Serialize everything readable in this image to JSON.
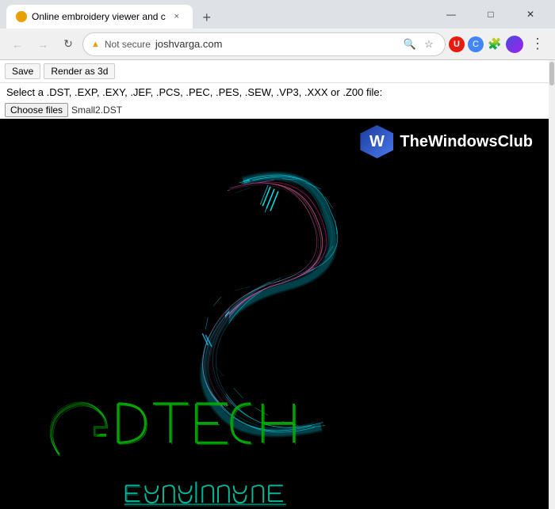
{
  "browser": {
    "tab": {
      "favicon_color": "#e8a000",
      "title": "Online embroidery viewer and c",
      "close_label": "×"
    },
    "new_tab_label": "+",
    "window_controls": {
      "minimize": "—",
      "maximize": "□",
      "close": "✕"
    },
    "nav": {
      "back_label": "←",
      "forward_label": "→",
      "reload_label": "↻",
      "security_icon": "▲",
      "security_text": "Not secure",
      "address": "joshvarga.com",
      "search_icon": "🔍",
      "star_icon": "☆",
      "menu_dots": "⋮"
    },
    "extensions": {
      "u_label": "U",
      "c_label": "C",
      "puzzle_label": "🧩"
    }
  },
  "page": {
    "toolbar": {
      "save_label": "Save",
      "render3d_label": "Render as 3d"
    },
    "file_select": {
      "label": "Select a .DST, .EXP, .EXY, .JEF, .PCS, .PEC, .PES, .SEW, .VP3, .XXX or .Z00 file:",
      "button_label": "Choose files",
      "file_name": "Small2.DST"
    },
    "watermark": {
      "text": "TheWindowsClub"
    }
  }
}
